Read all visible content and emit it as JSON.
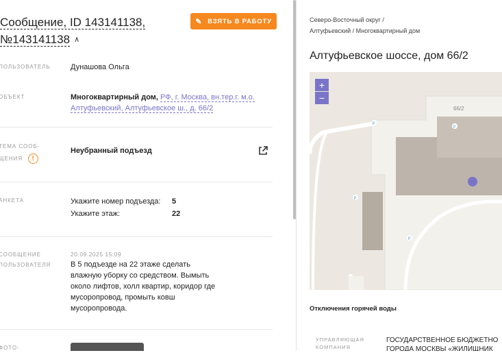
{
  "request": {
    "title_part1": "Сообщение, ID 143141138,",
    "title_part2": "№143141138",
    "take_button": "ВЗЯТЬ В РАБОТУ"
  },
  "fields": {
    "user_label": "ПОЛЬЗОВАТЕЛЬ",
    "user_value": "Дунашова Ольга",
    "object_label": "ОБЪЕКТ",
    "object_type": "Многоквартирный дом,",
    "object_address": "РФ, г. Москва, вн.тер.г. м.о. Алтуфьевский, Алтуфьевское ш., д. 66/2",
    "topic_label_1": "ТЕМА СООБ-",
    "topic_label_2": "ЩЕНИЯ",
    "topic_value": "Неубранный подъезд",
    "form_label": "АНКЕТА",
    "form_items": [
      {
        "question": "Укажите номер подъезда:",
        "answer": "5"
      },
      {
        "question": "Укажите этаж:",
        "answer": "22"
      }
    ],
    "message_label_1": "СООБЩЕНИЕ",
    "message_label_2": "ПОЛЬЗОВАТЕЛЯ",
    "message_date": "20.09.2025 15:09",
    "message_text": "В 5 подъезде на 22 этаже сделать влажную уборку со средством. Вымыть около лифтов, холл квартир, коридор где мусоропровод, промыть ковш мусоропровода.",
    "photo_label": "ФОТО-"
  },
  "location": {
    "breadcrumb_line1": "Северо-Восточный округ /",
    "breadcrumb_line2": "Алтуфьевский / Многоквартирный дом",
    "address": "Алтуфьевское шоссе, дом 66/2",
    "map_house_label": "66/2",
    "zoom_in": "+",
    "zoom_out": "−",
    "hot_water_title": "Отключения горячей воды",
    "mc_label_1": "УПРАВЛЯЮЩАЯ",
    "mc_label_2": "КОМПАНИЯ",
    "mc_value_1": "ГОСУДАРСТВЕННОЕ БЮДЖЕТНО",
    "mc_value_2": "ГОРОДА МОСКВЫ «ЖИЛИЩНИК"
  },
  "colors": {
    "accent_orange": "#f5891f",
    "accent_purple": "#7a74c9"
  }
}
